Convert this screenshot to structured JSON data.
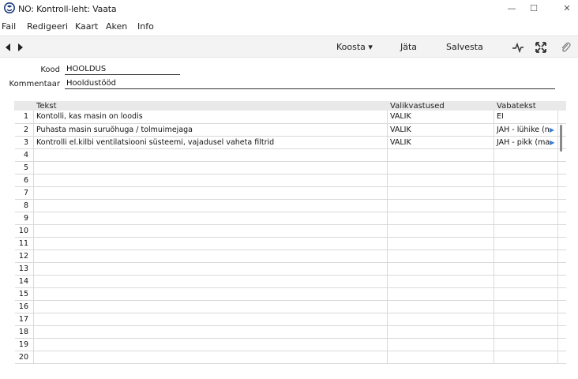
{
  "window": {
    "title": "NO: Kontroll-leht: Vaata",
    "icon": "app-logo-icon",
    "controls": {
      "minimize": "—",
      "maximize": "☐",
      "close": "✕"
    }
  },
  "menu": {
    "items": [
      {
        "label": "Fail"
      },
      {
        "label": "Redigeeri"
      },
      {
        "label": "Kaart"
      },
      {
        "label": "Aken"
      },
      {
        "label": "Info"
      }
    ]
  },
  "toolbar": {
    "prev_icon": "arrow-left-icon",
    "next_icon": "arrow-right-icon",
    "koosta_label": "Koosta ▾",
    "jata_label": "Jäta",
    "salvesta_label": "Salvesta",
    "pulse_icon": "pulse-icon",
    "expand_icon": "expand-icon",
    "attach_icon": "paperclip-icon"
  },
  "form": {
    "kood_label": "Kood",
    "kood_value": "HOOLDUS",
    "kommentaar_label": "Kommentaar",
    "kommentaar_value": "Hooldustööd"
  },
  "table": {
    "columns": [
      "",
      "Tekst",
      "Valikvastused",
      "Vabatekst"
    ],
    "rows": [
      {
        "num": "1",
        "tekst": "Kontolli, kas masin on loodis",
        "valik": "VALIK",
        "vaba": "EI",
        "arrow": false
      },
      {
        "num": "2",
        "tekst": "Puhasta masin suruõhuga / tolmuimejaga",
        "valik": "VALIK",
        "vaba": "JAH - lühike (n",
        "arrow": true
      },
      {
        "num": "3",
        "tekst": "Kontrolli el.kilbi ventilatsiooni süsteemi, vajadusel vaheta filtrid",
        "valik": "VALIK",
        "vaba": "JAH - pikk (ma",
        "arrow": true
      },
      {
        "num": "4",
        "tekst": "",
        "valik": "",
        "vaba": "",
        "arrow": false
      },
      {
        "num": "5",
        "tekst": "",
        "valik": "",
        "vaba": "",
        "arrow": false
      },
      {
        "num": "6",
        "tekst": "",
        "valik": "",
        "vaba": "",
        "arrow": false
      },
      {
        "num": "7",
        "tekst": "",
        "valik": "",
        "vaba": "",
        "arrow": false
      },
      {
        "num": "8",
        "tekst": "",
        "valik": "",
        "vaba": "",
        "arrow": false
      },
      {
        "num": "9",
        "tekst": "",
        "valik": "",
        "vaba": "",
        "arrow": false
      },
      {
        "num": "10",
        "tekst": "",
        "valik": "",
        "vaba": "",
        "arrow": false
      },
      {
        "num": "11",
        "tekst": "",
        "valik": "",
        "vaba": "",
        "arrow": false
      },
      {
        "num": "12",
        "tekst": "",
        "valik": "",
        "vaba": "",
        "arrow": false
      },
      {
        "num": "13",
        "tekst": "",
        "valik": "",
        "vaba": "",
        "arrow": false
      },
      {
        "num": "14",
        "tekst": "",
        "valik": "",
        "vaba": "",
        "arrow": false
      },
      {
        "num": "15",
        "tekst": "",
        "valik": "",
        "vaba": "",
        "arrow": false
      },
      {
        "num": "16",
        "tekst": "",
        "valik": "",
        "vaba": "",
        "arrow": false
      },
      {
        "num": "17",
        "tekst": "",
        "valik": "",
        "vaba": "",
        "arrow": false
      },
      {
        "num": "18",
        "tekst": "",
        "valik": "",
        "vaba": "",
        "arrow": false
      },
      {
        "num": "19",
        "tekst": "",
        "valik": "",
        "vaba": "",
        "arrow": false
      },
      {
        "num": "20",
        "tekst": "",
        "valik": "",
        "vaba": "",
        "arrow": false
      }
    ]
  },
  "colors": {
    "accent": "#3a7bd5",
    "toolbar_bg": "#f3f3f3",
    "header_bg": "#e9e9e9"
  }
}
